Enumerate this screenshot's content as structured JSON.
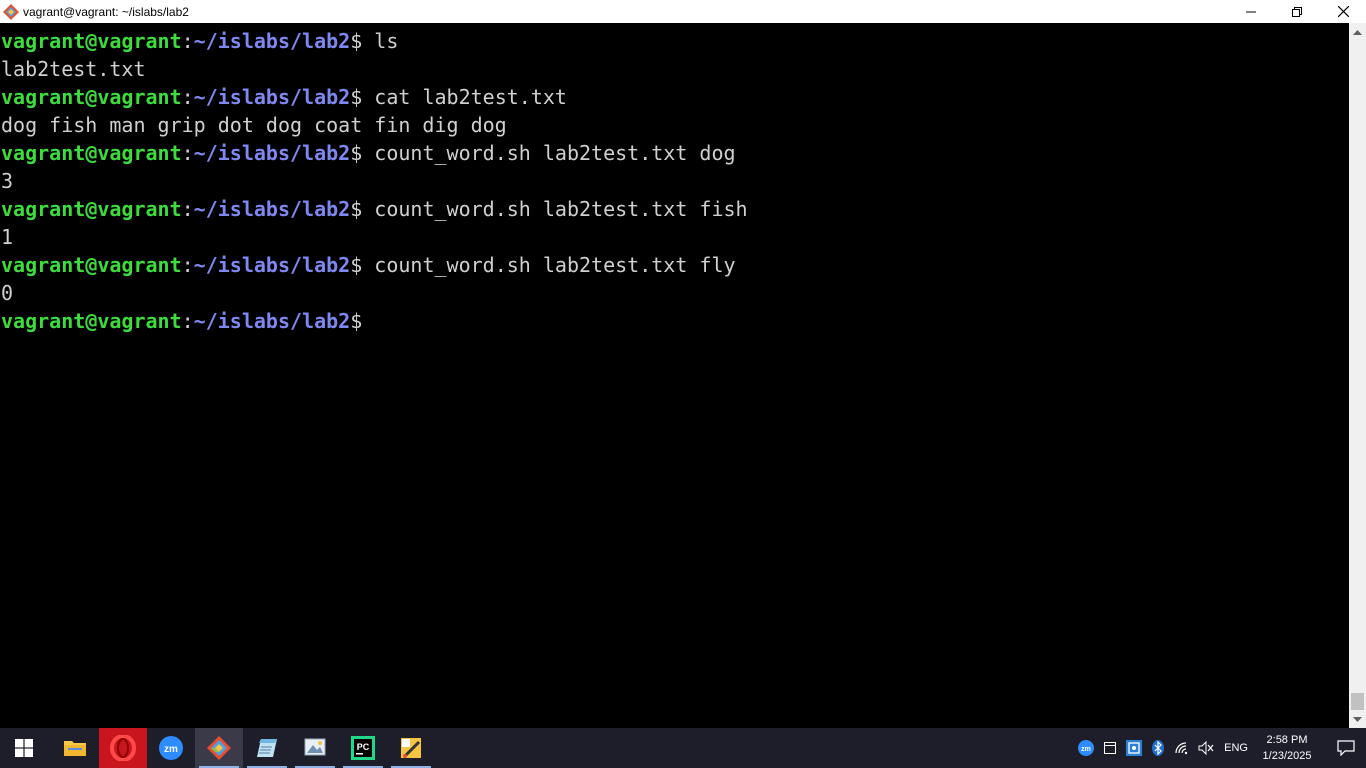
{
  "window": {
    "title": "vagrant@vagrant: ~/islabs/lab2"
  },
  "terminal": {
    "lines": [
      {
        "type": "prompt",
        "user": "vagrant@vagrant",
        "colon": ":",
        "path": "~/islabs/lab2",
        "dollar": "$",
        "cmd": " ls"
      },
      {
        "type": "output",
        "text": "lab2test.txt"
      },
      {
        "type": "prompt",
        "user": "vagrant@vagrant",
        "colon": ":",
        "path": "~/islabs/lab2",
        "dollar": "$",
        "cmd": " cat lab2test.txt"
      },
      {
        "type": "output",
        "text": "dog fish man grip dot dog coat fin dig dog"
      },
      {
        "type": "prompt",
        "user": "vagrant@vagrant",
        "colon": ":",
        "path": "~/islabs/lab2",
        "dollar": "$",
        "cmd": " count_word.sh lab2test.txt dog"
      },
      {
        "type": "output",
        "text": "3"
      },
      {
        "type": "prompt",
        "user": "vagrant@vagrant",
        "colon": ":",
        "path": "~/islabs/lab2",
        "dollar": "$",
        "cmd": " count_word.sh lab2test.txt fish"
      },
      {
        "type": "output",
        "text": "1"
      },
      {
        "type": "prompt",
        "user": "vagrant@vagrant",
        "colon": ":",
        "path": "~/islabs/lab2",
        "dollar": "$",
        "cmd": " count_word.sh lab2test.txt fly"
      },
      {
        "type": "output",
        "text": "0"
      },
      {
        "type": "prompt",
        "user": "vagrant@vagrant",
        "colon": ":",
        "path": "~/islabs/lab2",
        "dollar": "$",
        "cmd": ""
      }
    ],
    "colors": {
      "user": "#3ddc3d",
      "path": "#7f88f0",
      "text": "#d0d0d0",
      "background": "#000000"
    }
  },
  "taskbar": {
    "apps": [
      {
        "name": "start-button",
        "icon": "windows-logo-icon"
      },
      {
        "name": "file-explorer",
        "icon": "folder-icon"
      },
      {
        "name": "opera",
        "icon": "opera-icon"
      },
      {
        "name": "zoom",
        "icon": "zoom-icon"
      },
      {
        "name": "git-bash",
        "icon": "git-icon",
        "active": true
      },
      {
        "name": "notepad",
        "icon": "notepad-icon"
      },
      {
        "name": "photos",
        "icon": "photos-icon"
      },
      {
        "name": "pycharm",
        "icon": "pycharm-icon"
      },
      {
        "name": "paint",
        "icon": "paint-icon"
      }
    ],
    "tray": {
      "language": "ENG",
      "time": "2:58 PM",
      "date": "1/23/2025"
    }
  }
}
